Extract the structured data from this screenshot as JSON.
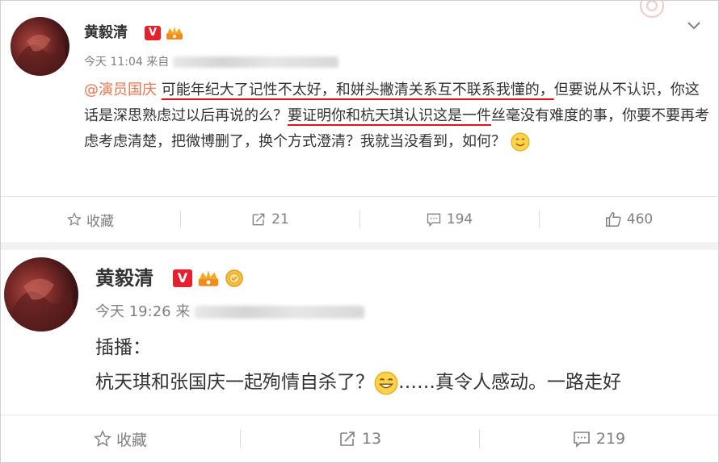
{
  "post1": {
    "author": "黄毅清",
    "time": "今天 11:04",
    "source_prefix": "来自",
    "mention": "@演员国庆",
    "segments": [
      {
        "text": " ",
        "ul": false
      },
      {
        "text": "可能年纪大了记性不太好，和姘头撇清关系互不联系我懂的，",
        "ul": true
      },
      {
        "text": "但要说从不认识，你这话是深思熟虑过以后再说的么？",
        "ul": false
      },
      {
        "text": "要证明你和杭天琪认识这是一件",
        "ul": true
      },
      {
        "text": "丝毫没有难度的事，你要不要再考虑考虑清楚，把微博删了，换个方式澄清？我就当没看到，如何？",
        "ul": false
      }
    ],
    "actions": {
      "favorite": "收藏",
      "repost": "21",
      "comment": "194",
      "like": "460"
    }
  },
  "post2": {
    "author": "黄毅清",
    "time": "今天 19:26",
    "source_prefix": "来",
    "line1": "插播：",
    "line2_a": "杭天琪和张国庆一起殉情自杀了？",
    "line2_b": "……真令人感动。一路走好",
    "actions": {
      "favorite": "收藏",
      "repost": "13",
      "comment": "219"
    }
  },
  "colors": {
    "mention": "#eb7350",
    "underline": "#e0151b",
    "verified": "#e5212e",
    "meta": "#808080"
  },
  "icons": [
    "dropdown-chevron-icon",
    "verified-icon",
    "crown-icon",
    "medal-icon",
    "smile-emoji-icon",
    "star-icon",
    "repost-icon",
    "comment-icon",
    "thumb-up-icon"
  ]
}
